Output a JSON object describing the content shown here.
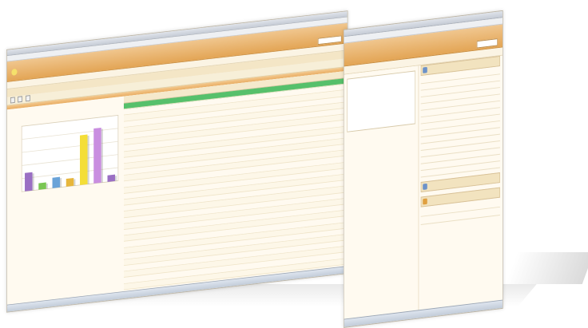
{
  "left_window": {
    "banner": {
      "logo_text": ""
    },
    "crumb": "",
    "filter_buttons": [
      "",
      "",
      ""
    ],
    "chart_data": {
      "type": "bar",
      "categories": [
        "",
        "",
        "",
        "",
        "",
        "",
        ""
      ],
      "values": [
        14,
        5,
        8,
        6,
        38,
        42,
        5
      ],
      "colors": [
        "#9a6fc4",
        "#7ac653",
        "#6aa3d8",
        "#e7b63c",
        "#f4de37",
        "#c98ee0",
        "#9a6fc4"
      ],
      "ylim": [
        0,
        50
      ]
    },
    "table": {
      "headers": [
        "",
        "",
        "",
        "",
        "",
        ""
      ],
      "rows": [
        {
          "highlight": true
        },
        {},
        {},
        {},
        {},
        {},
        {},
        {},
        {},
        {},
        {},
        {},
        {},
        {},
        {},
        {},
        {},
        {},
        {},
        {},
        {},
        {},
        {},
        {},
        {},
        {},
        {},
        {},
        {},
        {},
        {},
        {}
      ]
    }
  },
  "right_window": {
    "panel_agenda_title": "",
    "panel_tasks_title": "",
    "panel_info_title": "",
    "agenda_rows": [
      {
        "time": "",
        "event": ""
      },
      {
        "time": "",
        "event": ""
      },
      {
        "time": "",
        "event": ""
      },
      {
        "time": "",
        "event": ""
      },
      {
        "time": "",
        "event": ""
      },
      {
        "time": "",
        "event": ""
      },
      {
        "time": "",
        "event": ""
      },
      {
        "time": "",
        "event": ""
      },
      {
        "time": "",
        "event": ""
      },
      {
        "time": "",
        "event": ""
      },
      {
        "time": "",
        "event": ""
      },
      {
        "time": "",
        "event": ""
      },
      {
        "time": "",
        "event": ""
      },
      {
        "time": "",
        "event": ""
      },
      {
        "time": "",
        "event": ""
      }
    ],
    "info_rows": [
      {
        "k": "",
        "v": ""
      },
      {
        "k": "",
        "v": ""
      }
    ]
  }
}
